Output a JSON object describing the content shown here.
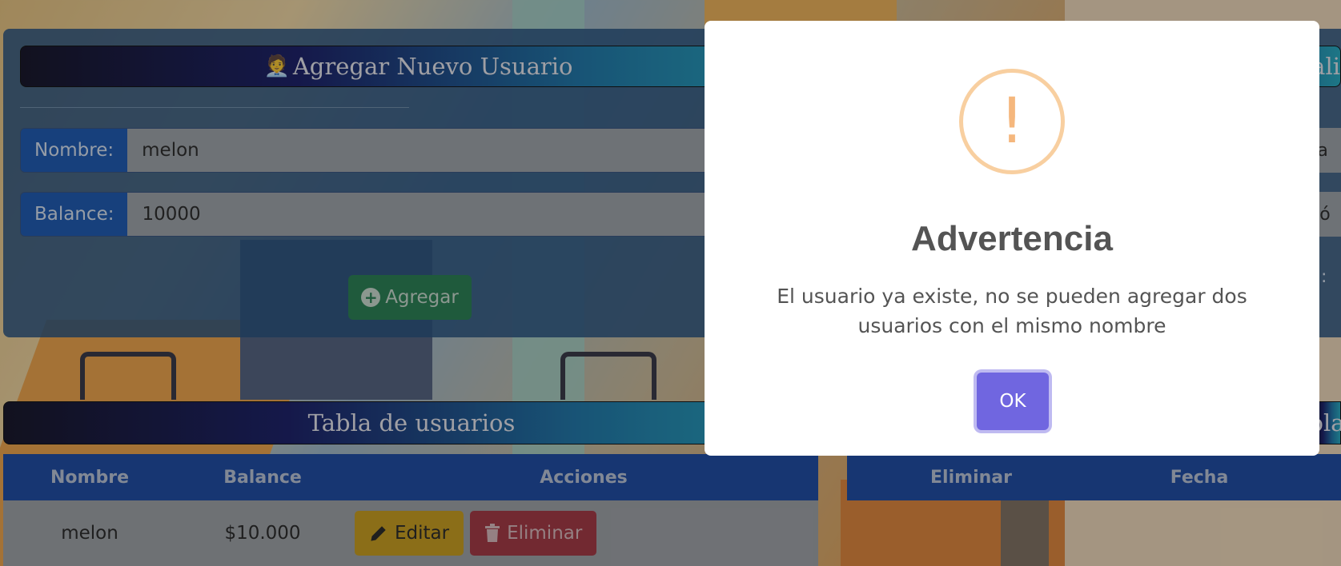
{
  "add_user": {
    "title_emoji": "🧑‍💼",
    "title": "Agregar Nuevo Usuario",
    "nombre_label": "Nombre:",
    "nombre_value": "melon",
    "balance_label": "Balance:",
    "balance_value": "10000",
    "add_button": "Agregar"
  },
  "right_panel": {
    "title_fragment": "ali",
    "field1_fragment": "ona",
    "field2_fragment": "cció",
    "colon": ":"
  },
  "users_table": {
    "title": "Tabla de usuarios",
    "columns": [
      "Nombre",
      "Balance",
      "Acciones"
    ],
    "rows": [
      {
        "nombre": "melon",
        "balance": "$10.000",
        "edit_label": "Editar",
        "delete_label": "Eliminar"
      }
    ]
  },
  "transfers_table": {
    "title_fragment": "ola",
    "columns": [
      "Eliminar",
      "Fecha"
    ]
  },
  "modal": {
    "icon": "!",
    "title": "Advertencia",
    "message": "El usuario ya existe, no se pueden agregar dos usuarios con el mismo nombre",
    "ok_label": "OK"
  },
  "colors": {
    "primary_blue": "#0d4fb0",
    "success_green": "#1b7a4a",
    "warning_yellow": "#c99a10",
    "danger_red": "#a02a38",
    "modal_button": "#7066e0",
    "warning_icon": "#f8cfa0"
  }
}
